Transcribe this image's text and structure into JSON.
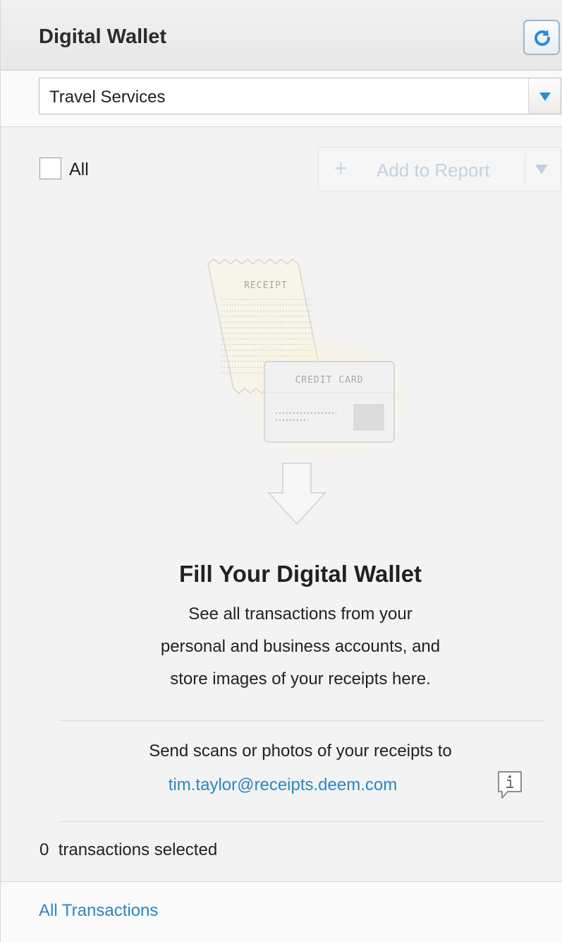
{
  "header": {
    "title": "Digital Wallet",
    "refresh_icon": "refresh-icon"
  },
  "filter": {
    "selected": "Travel Services"
  },
  "toolbar": {
    "select_all_label": "All",
    "add_label": "Add to Report"
  },
  "illustration": {
    "receipt_label": "RECEIPT",
    "card_label": "CREDIT CARD"
  },
  "empty_state": {
    "headline": "Fill Your Digital Wallet",
    "lines": [
      "See all transactions from your",
      "personal and business accounts, and",
      "store images of your receipts here."
    ],
    "send_text": "Send scans or photos of your receipts to",
    "email": "tim.taylor@receipts.deem.com"
  },
  "status": {
    "count": "0",
    "label": "transactions selected"
  },
  "footer": {
    "link": "All Transactions"
  },
  "colors": {
    "link": "#2e86c1",
    "accent": "#2a8dd4"
  }
}
